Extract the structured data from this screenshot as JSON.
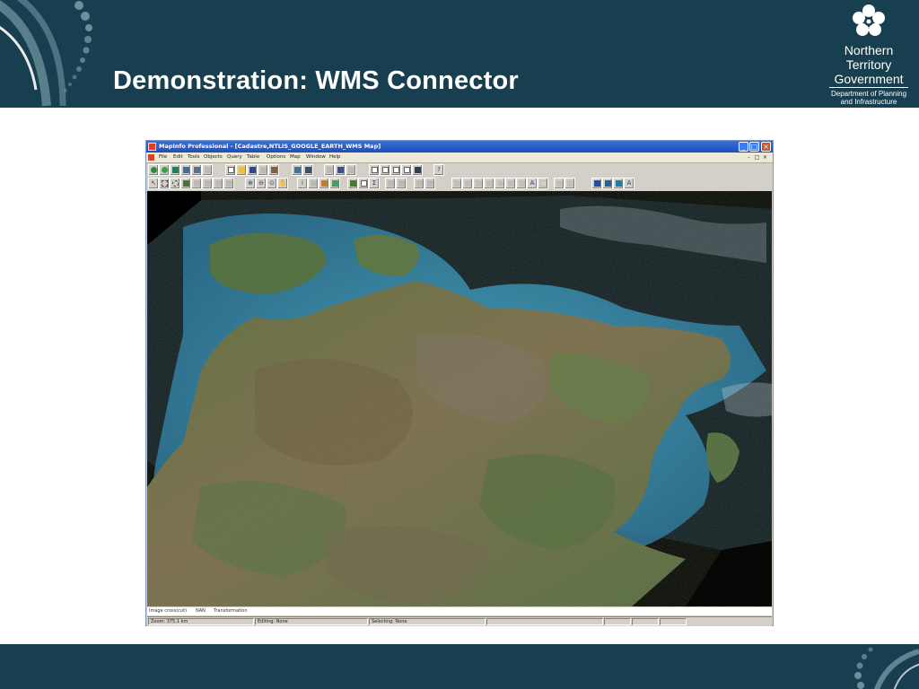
{
  "slide": {
    "title": "Demonstration: WMS Connector",
    "logo": {
      "line1": "Northern",
      "line2": "Territory",
      "line3": "Government",
      "line4": "Department of Planning",
      "line5": "and Infrastructure"
    },
    "colors": {
      "band": "#173f4f",
      "swirl": "#8fb3c0"
    }
  },
  "app": {
    "title": "MapInfo Professional - [Cadastre,NTLIS_GOOGLE_EARTH_WMS Map]",
    "menu": [
      "File",
      "Edit",
      "Tools",
      "Objects",
      "Query",
      "Table",
      "Options",
      "Map",
      "Window",
      "Help"
    ],
    "toolbar1_icons": [
      "open-table-icon",
      "new-table-icon",
      "open-workspace-icon",
      "save-workspace-icon",
      "print-icon",
      "cut-icon",
      "new-document-icon",
      "open-icon",
      "save-icon",
      "copy-icon",
      "paste-icon",
      "layer-control-icon",
      "browser-icon",
      "map-window-icon",
      "graph-icon",
      "layout-icon",
      "redistrict-icon",
      "statistics-icon",
      "legend-icon",
      "help-pointer-icon"
    ],
    "toolbar2_icons": [
      "select-arrow-icon",
      "marquee-select-icon",
      "radius-select-icon",
      "polygon-select-icon",
      "boundary-select-icon",
      "unselect-icon",
      "invert-select-icon",
      "graph-select-icon",
      "zoom-in-icon",
      "zoom-out-icon",
      "change-view-icon",
      "grabber-icon",
      "info-icon",
      "hotlink-icon",
      "label-icon",
      "drag-map-icon",
      "layer-icon",
      "ruler-icon",
      "sum-icon",
      "thematic-icon",
      "legend-create-icon",
      "clip-region-icon",
      "symbol-icon",
      "line-icon",
      "polyline-icon",
      "arc-icon",
      "polygon-icon",
      "ellipse-icon",
      "rectangle-icon",
      "rounded-rect-icon",
      "text-icon",
      "frame-icon",
      "reshape-icon",
      "add-node-icon",
      "symbol-style-icon",
      "line-style-icon",
      "region-style-icon",
      "text-style-icon"
    ],
    "status_line": {
      "left": "Image cross(cut)",
      "middle": "NAN",
      "right": "Transformation"
    },
    "statusbar": {
      "zoom": "Zoom: 375.1 km",
      "editing": "Editing: None",
      "selecting": "Selecting: None"
    }
  }
}
